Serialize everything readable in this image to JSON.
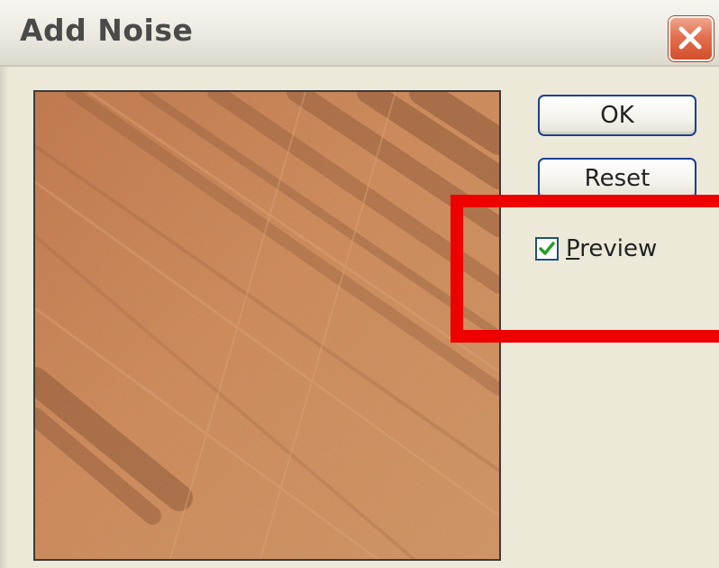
{
  "window": {
    "title": "Add Noise",
    "close_icon": "close-icon"
  },
  "preview": {
    "description_icon": "noise-preview-image",
    "texture_colors": [
      "#c87a45",
      "#d99a63",
      "#8a4a26",
      "#3a1f10"
    ]
  },
  "buttons": {
    "ok_label": "OK",
    "reset_label": "Reset"
  },
  "preview_checkbox": {
    "label_first": "P",
    "label_rest": "review",
    "checked": true,
    "check_color": "#21a121"
  },
  "annotation": {
    "highlight_color": "#ee0000"
  }
}
